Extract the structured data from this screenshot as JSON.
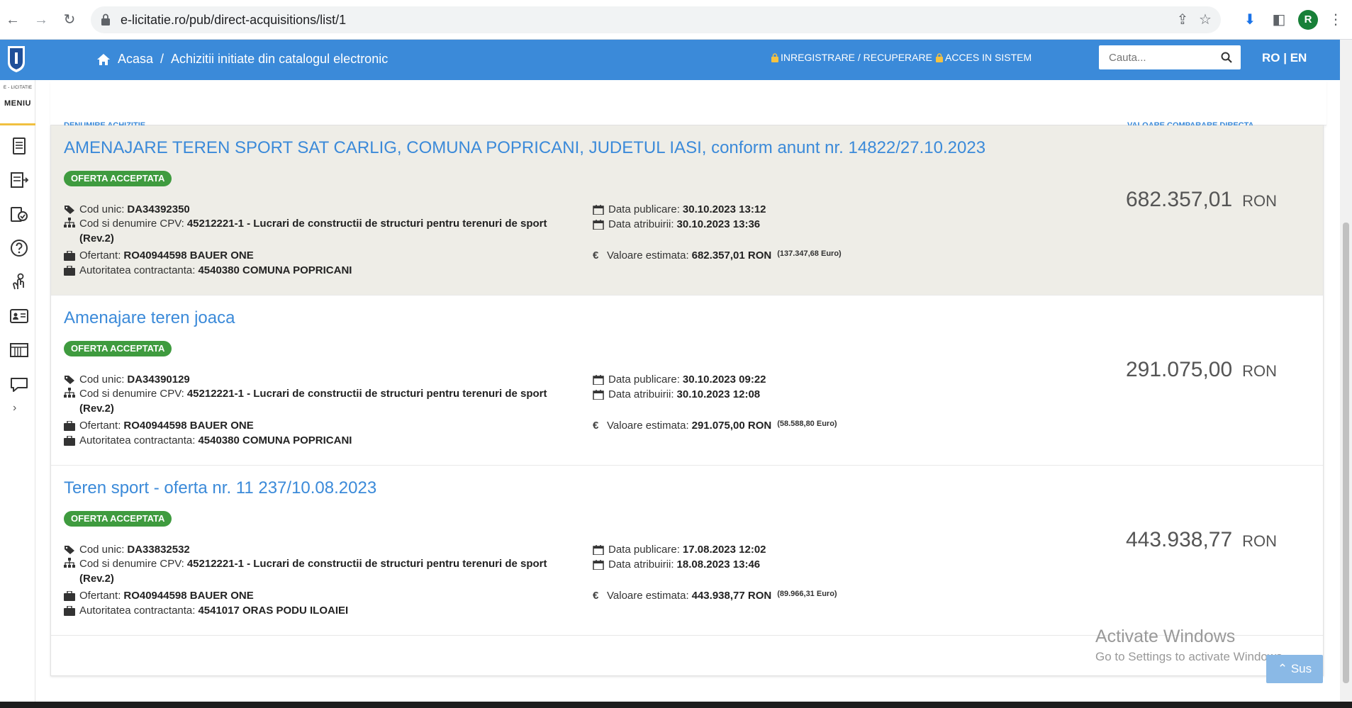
{
  "browser": {
    "url": "e-licitatie.ro/pub/direct-acquisitions/list/1",
    "profile_initial": "R"
  },
  "header": {
    "home_label": "Acasa",
    "separator": "/",
    "page_label": "Achizitii initiate din catalogul electronic",
    "register_label": "INREGISTRARE / RECUPERARE",
    "login_label": "ACCES IN SISTEM",
    "search_placeholder": "Cauta...",
    "lang_label": "RO | EN"
  },
  "sidebar": {
    "brand": "E - LICITATIE",
    "menu_label": "MENIU",
    "expand_glyph": "›"
  },
  "columns": {
    "name": "DENUMIRE ACHIZITIE",
    "value": "VALOARE COMPARARE DIRECTA"
  },
  "labels": {
    "code": "Cod unic:",
    "cpv": "Cod si denumire CPV:",
    "bidder": "Ofertant:",
    "authority": "Autoritatea contractanta:",
    "published": "Data publicare:",
    "awarded": "Data atribuirii:",
    "estimated": "Valoare estimata:",
    "euro_sign": "€"
  },
  "items": [
    {
      "title": "AMENAJARE TEREN SPORT SAT CARLIG, COMUNA POPRICANI, JUDETUL IASI, conform anunt nr. 14822/27.10.2023",
      "status": "OFERTA ACCEPTATA",
      "code": "DA34392350",
      "cpv": "45212221-1 - Lucrari de constructii de structuri pentru terenuri de sport (Rev.2)",
      "bidder": "RO40944598 BAUER ONE",
      "authority": "4540380 COMUNA POPRICANI",
      "published": "30.10.2023 13:12",
      "awarded": "30.10.2023 13:36",
      "estimated": "682.357,01  RON",
      "estimated_euro": "(137.347,68  Euro)",
      "price": "682.357,01",
      "currency": "RON"
    },
    {
      "title": "Amenajare teren joaca",
      "status": "OFERTA ACCEPTATA",
      "code": "DA34390129",
      "cpv": "45212221-1 - Lucrari de constructii de structuri pentru terenuri de sport (Rev.2)",
      "bidder": "RO40944598 BAUER ONE",
      "authority": "4540380 COMUNA POPRICANI",
      "published": "30.10.2023 09:22",
      "awarded": "30.10.2023 12:08",
      "estimated": "291.075,00  RON",
      "estimated_euro": "(58.588,80  Euro)",
      "price": "291.075,00",
      "currency": "RON"
    },
    {
      "title": "Teren sport - oferta nr. 11 237/10.08.2023",
      "status": "OFERTA ACCEPTATA",
      "code": "DA33832532",
      "cpv": "45212221-1 - Lucrari de constructii de structuri pentru terenuri de sport (Rev.2)",
      "bidder": "RO40944598 BAUER ONE",
      "authority": "4541017 ORAS PODU ILOAIEI",
      "published": "17.08.2023 12:02",
      "awarded": "18.08.2023 13:46",
      "estimated": "443.938,77  RON",
      "estimated_euro": "(89.966,31  Euro)",
      "price": "443.938,77",
      "currency": "RON"
    }
  ],
  "watermark": {
    "line1": "Activate Windows",
    "line2": "Go to Settings to activate Windows."
  },
  "back_to_top": "Sus",
  "colors": {
    "header_blue": "#3b8ad9",
    "badge_green": "#3f9b3f",
    "highlight_row": "#eeede7"
  }
}
